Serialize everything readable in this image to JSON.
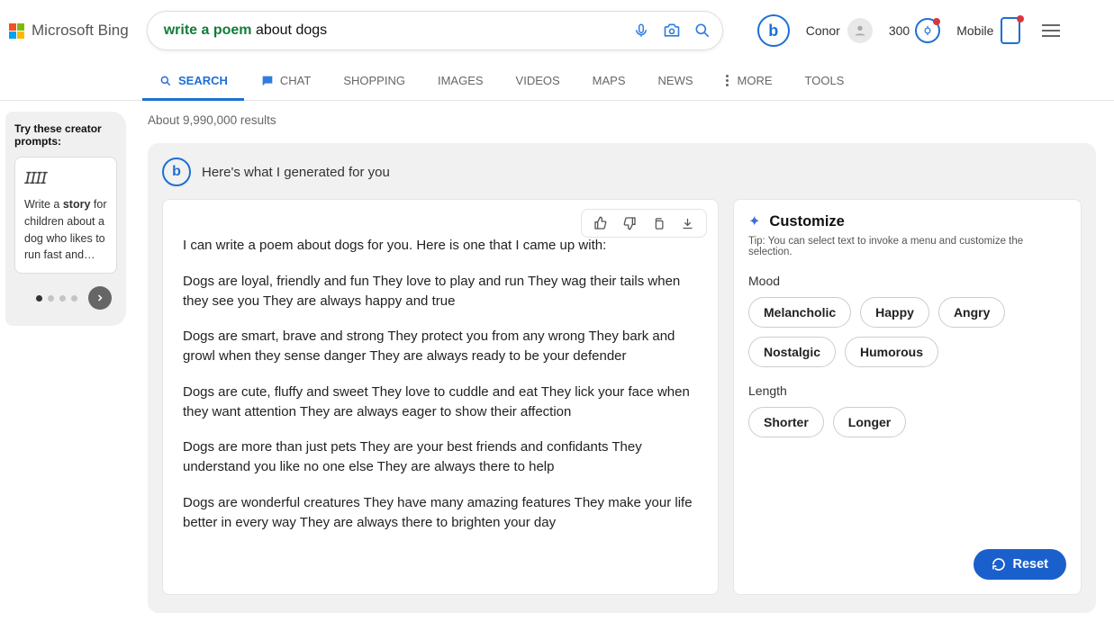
{
  "logo": "Microsoft Bing",
  "search": {
    "highlight": "write a poem",
    "rest": " about dogs"
  },
  "user": {
    "name": "Conor",
    "points": "300",
    "mobile_label": "Mobile"
  },
  "tabs": [
    "SEARCH",
    "CHAT",
    "SHOPPING",
    "IMAGES",
    "VIDEOS",
    "MAPS",
    "NEWS",
    "MORE",
    "TOOLS"
  ],
  "results_count": "About 9,990,000 results",
  "sidebar": {
    "title": "Try these creator prompts:",
    "prompt_prefix": "Write a ",
    "prompt_strong": "story",
    "prompt_suffix": " for children about a dog who likes to run fast and…"
  },
  "ai": {
    "title": "Here's what I generated for you",
    "paragraphs": [
      "I can write a poem about dogs for you. Here is one that I came up with:",
      "Dogs are loyal, friendly and fun They love to play and run They wag their tails when they see you They are always happy and true",
      "Dogs are smart, brave and strong They protect you from any wrong They bark and growl when they sense danger They are always ready to be your defender",
      "Dogs are cute, fluffy and sweet They love to cuddle and eat They lick your face when they want attention They are always eager to show their affection",
      "Dogs are more than just pets They are your best friends and confidants They understand you like no one else They are always there to help",
      "Dogs are wonderful creatures They have many amazing features They make your life better in every way They are always there to brighten your day"
    ]
  },
  "customize": {
    "title": "Customize",
    "tip": "Tip: You can select text to invoke a menu and customize the selection.",
    "mood_label": "Mood",
    "moods": [
      "Melancholic",
      "Happy",
      "Angry",
      "Nostalgic",
      "Humorous"
    ],
    "length_label": "Length",
    "lengths": [
      "Shorter",
      "Longer"
    ],
    "reset": "Reset"
  }
}
